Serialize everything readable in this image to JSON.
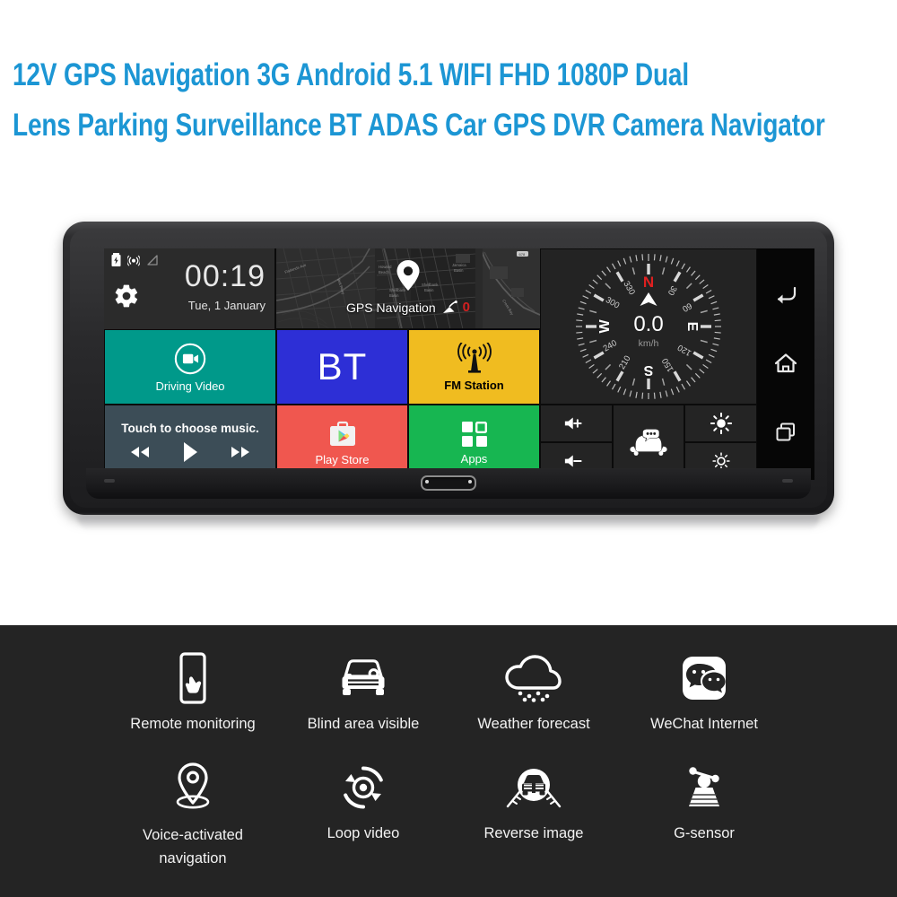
{
  "title": {
    "line1": "12V GPS Navigation 3G Android 5.1 WIFI FHD 1080P Dual",
    "line2": "Lens Parking Surveillance BT ADAS Car GPS DVR Camera Navigator",
    "color": "#1c96d4"
  },
  "device": {
    "screen": {
      "statusbar": {
        "battery_icon": "battery-charging-icon",
        "hotspot_icon": "wifi-hotspot-icon",
        "signal_icon": "signal-strength-icon"
      },
      "clock_widget": {
        "settings_icon": "gear-icon",
        "time": "00:19",
        "date": "Tue, 1 January"
      },
      "map_tile": {
        "label": "GPS Navigation",
        "satellite_icon": "satellite-dish-icon",
        "satellite_count": "0",
        "pin_icon": "map-pin-icon",
        "street_labels": [
          "Flatlands Ave",
          "Belt Pkwy",
          "Howard Beach",
          "Shellbank Basin",
          "Creek Park",
          "Spring Creek"
        ]
      },
      "tiles": [
        {
          "id": "driving-video",
          "label": "Driving Video",
          "icon": "video-camera-icon",
          "color": "#00998a"
        },
        {
          "id": "bluetooth",
          "label": "BT",
          "icon": "bt-text",
          "color": "#2d2fd6"
        },
        {
          "id": "fm-station",
          "label": "FM Station",
          "icon": "radio-tower-icon",
          "color": "#f0bc20"
        },
        {
          "id": "play-store",
          "label": "Play Store",
          "icon": "play-store-icon",
          "color": "#f0574f"
        },
        {
          "id": "apps",
          "label": "Apps",
          "icon": "apps-grid-icon",
          "color": "#17b651"
        }
      ],
      "music_player": {
        "title": "Touch to choose music.",
        "prev_icon": "previous-track-icon",
        "play_icon": "play-icon",
        "next_icon": "next-track-icon",
        "background": "#3c4d57"
      },
      "compass": {
        "speed": "0.0",
        "speed_unit": "km/h",
        "north": "N",
        "east": "E",
        "south": "S",
        "west": "W",
        "north_color": "#e02020",
        "degree_labels": [
          "30",
          "60",
          "120",
          "150",
          "210",
          "240",
          "300",
          "330"
        ],
        "needle_icon": "compass-needle-icon"
      },
      "controls": [
        {
          "id": "volume-up",
          "icon": "volume-up-icon"
        },
        {
          "id": "car-voice",
          "icon": "car-voice-icon"
        },
        {
          "id": "brightness-up",
          "icon": "brightness-high-icon"
        },
        {
          "id": "volume-down",
          "icon": "volume-down-icon"
        },
        {
          "id": "brightness-down",
          "icon": "brightness-low-icon"
        }
      ],
      "navbar": [
        {
          "id": "back",
          "icon": "back-arrow-icon"
        },
        {
          "id": "home",
          "icon": "home-icon"
        },
        {
          "id": "recents",
          "icon": "recent-apps-icon"
        }
      ]
    }
  },
  "features": {
    "row1": [
      {
        "label": "Remote monitoring",
        "icon": "phone-touch-icon"
      },
      {
        "label": "Blind area visible",
        "icon": "car-front-icon"
      },
      {
        "label": "Weather forecast",
        "icon": "cloud-rain-icon"
      },
      {
        "label": "WeChat Internet",
        "icon": "wechat-icon"
      }
    ],
    "row2": [
      {
        "label": "Voice-activated navigation",
        "icon": "location-pin-icon"
      },
      {
        "label": "Loop video",
        "icon": "loop-recording-icon"
      },
      {
        "label": "Reverse image",
        "icon": "reverse-camera-icon"
      },
      {
        "label": "G-sensor",
        "icon": "g-sensor-icon"
      }
    ]
  }
}
